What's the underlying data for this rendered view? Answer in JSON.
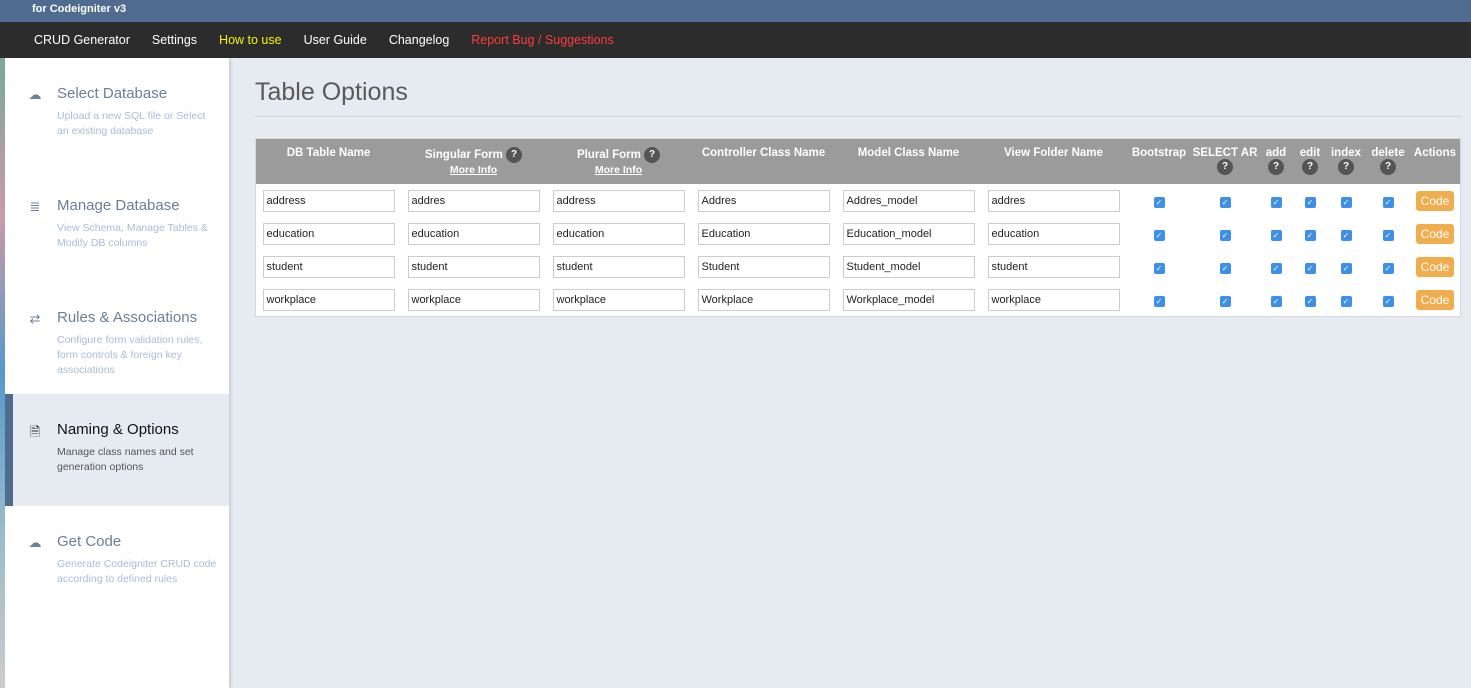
{
  "header": {
    "subtitle": "for Codeigniter v3"
  },
  "nav": [
    {
      "label": "CRUD Generator",
      "color": "#ffffff"
    },
    {
      "label": "Settings",
      "color": "#ffffff"
    },
    {
      "label": "How to use",
      "color": "#f5f500"
    },
    {
      "label": "User Guide",
      "color": "#ffffff"
    },
    {
      "label": "Changelog",
      "color": "#ffffff"
    },
    {
      "label": "Report Bug / Suggestions",
      "color": "#ff3b3b"
    }
  ],
  "sidebar": [
    {
      "icon": "cloud-upload-icon",
      "title": "Select Database",
      "desc": "Upload a new SQL file or Select an existing database"
    },
    {
      "icon": "database-icon",
      "title": "Manage Database",
      "desc": "View Schema, Manage Tables & Modify DB columns"
    },
    {
      "icon": "exchange-icon",
      "title": "Rules & Associations",
      "desc": "Configure form validation rules, form controls & foreign key associations"
    },
    {
      "icon": "file-icon",
      "title": "Naming & Options",
      "desc": "Manage class names and set generation options",
      "active": true
    },
    {
      "icon": "cloud-download-icon",
      "title": "Get Code",
      "desc": "Generate Codeigniter CRUD code according to defined rules"
    }
  ],
  "page_title": "Table Options",
  "table": {
    "headers": {
      "db": "DB Table Name",
      "singular": "Singular Form",
      "plural": "Plural Form",
      "more_info": "More Info",
      "controller": "Controller Class Name",
      "model": "Model Class Name",
      "view": "View Folder Name",
      "bootstrap": "Bootstrap",
      "select_ar": "SELECT AR",
      "add": "add",
      "edit": "edit",
      "index": "index",
      "delete": "delete",
      "actions": "Actions",
      "help": "?"
    },
    "rows": [
      {
        "db": "address",
        "singular": "addres",
        "plural": "address",
        "controller": "Addres",
        "model": "Addres_model",
        "view": "addres",
        "checks": [
          true,
          true,
          true,
          true,
          true,
          true
        ],
        "action": "Code"
      },
      {
        "db": "education",
        "singular": "education",
        "plural": "education",
        "controller": "Education",
        "model": "Education_model",
        "view": "education",
        "checks": [
          true,
          true,
          true,
          true,
          true,
          true
        ],
        "action": "Code"
      },
      {
        "db": "student",
        "singular": "student",
        "plural": "student",
        "controller": "Student",
        "model": "Student_model",
        "view": "student",
        "checks": [
          true,
          true,
          true,
          true,
          true,
          true
        ],
        "action": "Code"
      },
      {
        "db": "workplace",
        "singular": "workplace",
        "plural": "workplace",
        "controller": "Workplace",
        "model": "Workplace_model",
        "view": "workplace",
        "checks": [
          true,
          true,
          true,
          true,
          true,
          true
        ],
        "action": "Code"
      }
    ]
  }
}
